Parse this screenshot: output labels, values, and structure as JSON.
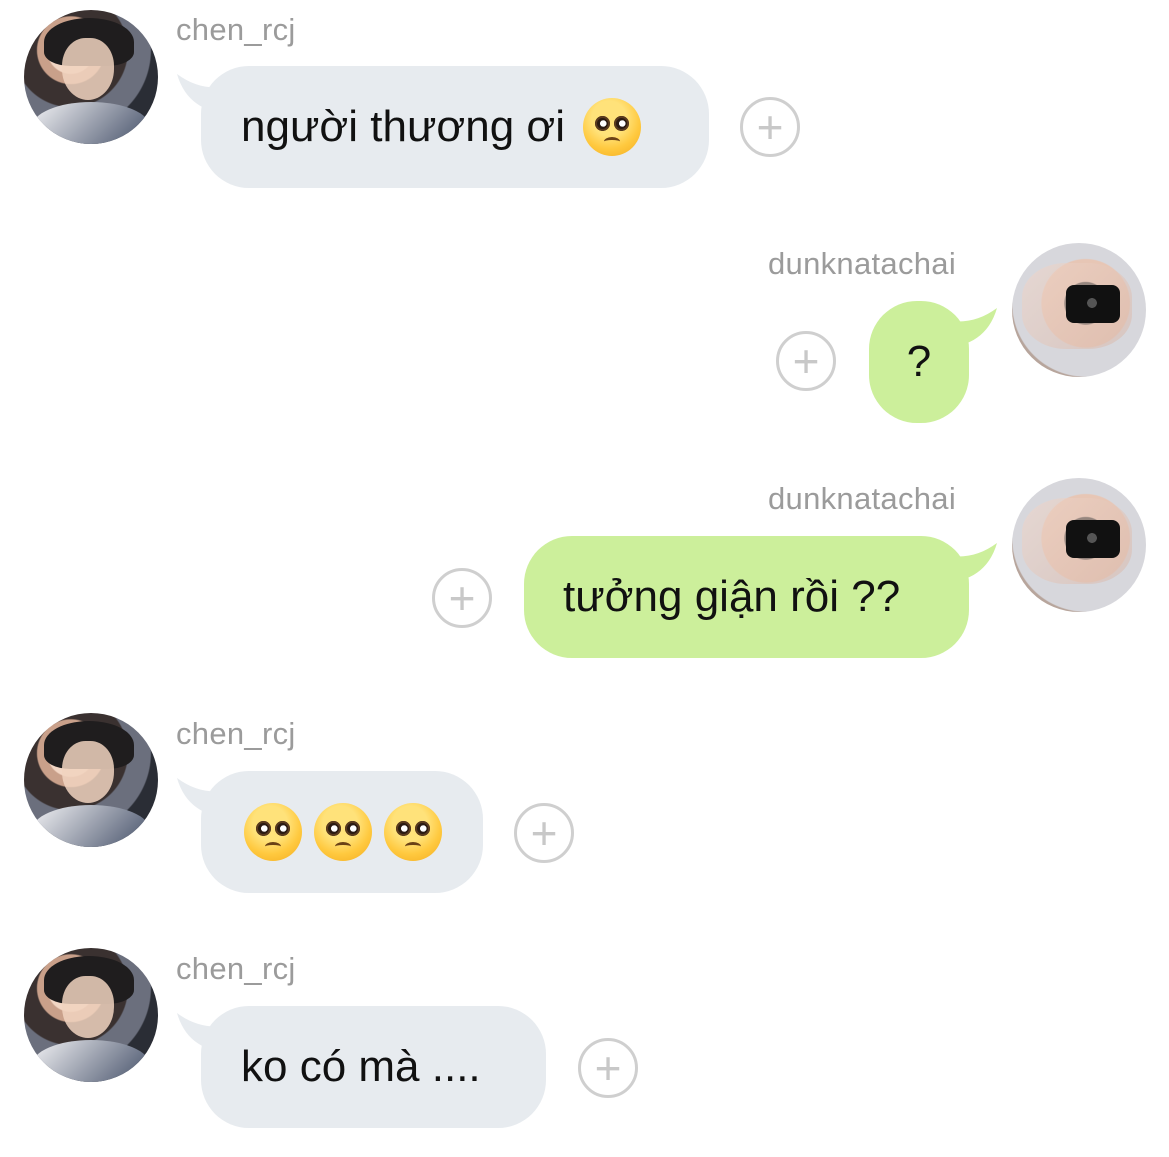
{
  "chat": {
    "messages": [
      {
        "sender": "chen_rcj",
        "direction": "incoming",
        "text": "người thương ơi",
        "emojis": [
          "pleading-face"
        ]
      },
      {
        "sender": "dunknatachai",
        "direction": "outgoing",
        "text": "?"
      },
      {
        "sender": "dunknatachai",
        "direction": "outgoing",
        "text": "tưởng giận rồi ??"
      },
      {
        "sender": "chen_rcj",
        "direction": "incoming",
        "text": "",
        "emojis": [
          "pleading-face",
          "pleading-face",
          "pleading-face"
        ]
      },
      {
        "sender": "chen_rcj",
        "direction": "incoming",
        "text": "ko có mà ...."
      }
    ],
    "add_button_label": "+"
  },
  "colors": {
    "incoming_bubble": "#e7ebef",
    "outgoing_bubble": "#ccef9b",
    "username": "#9b9b9b",
    "add_button": "#cfcfcf"
  },
  "icons": {
    "reaction": "plus-circle-icon",
    "emoji": "pleading-face-icon"
  }
}
